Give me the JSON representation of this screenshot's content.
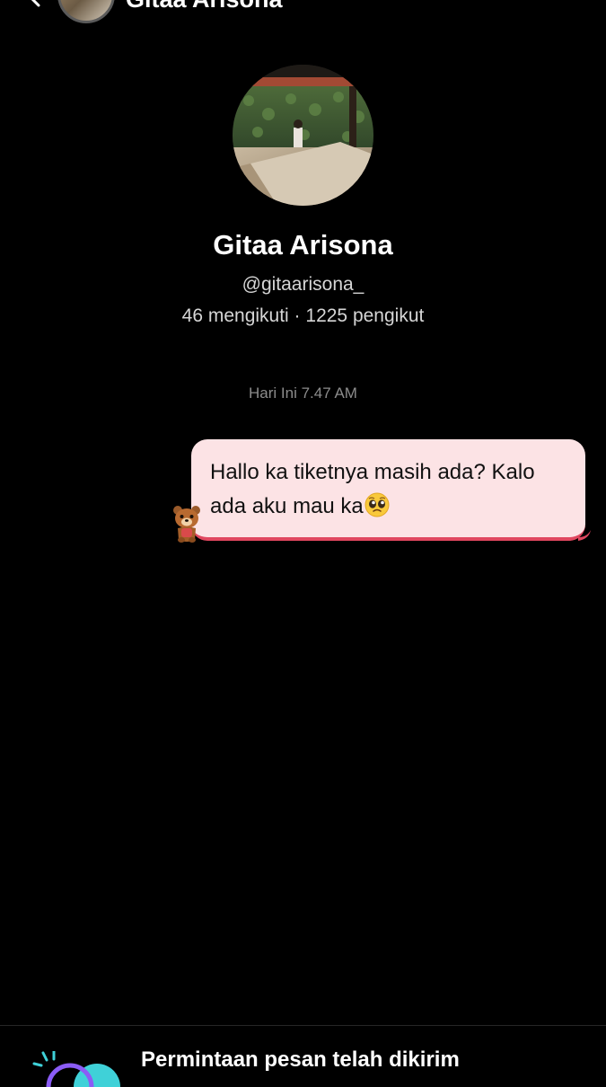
{
  "header": {
    "title": "Gitaa Arisona",
    "back_icon": "chevron-left-icon"
  },
  "profile": {
    "name": "Gitaa Arisona",
    "handle": "@gitaarisona_",
    "stats": "46 mengikuti · 1225 pengikut"
  },
  "conversation": {
    "timestamp": "Hari Ini 7.47 AM",
    "messages": [
      {
        "text": "Hallo ka tiketnya masih ada? Kalo ada aku mau ka",
        "emoji": "pleading-face-icon",
        "sticker": "bear-sticker-icon",
        "bubble_color": "#fce3e5",
        "accent_color": "#e0475f"
      }
    ]
  },
  "footer": {
    "request_title": "Permintaan pesan telah dikirim",
    "illustration": "message-request-illustration"
  },
  "colors": {
    "background": "#000000",
    "text_primary": "#ffffff",
    "text_secondary": "#d6d6d6",
    "timestamp": "#8c8c8c"
  }
}
